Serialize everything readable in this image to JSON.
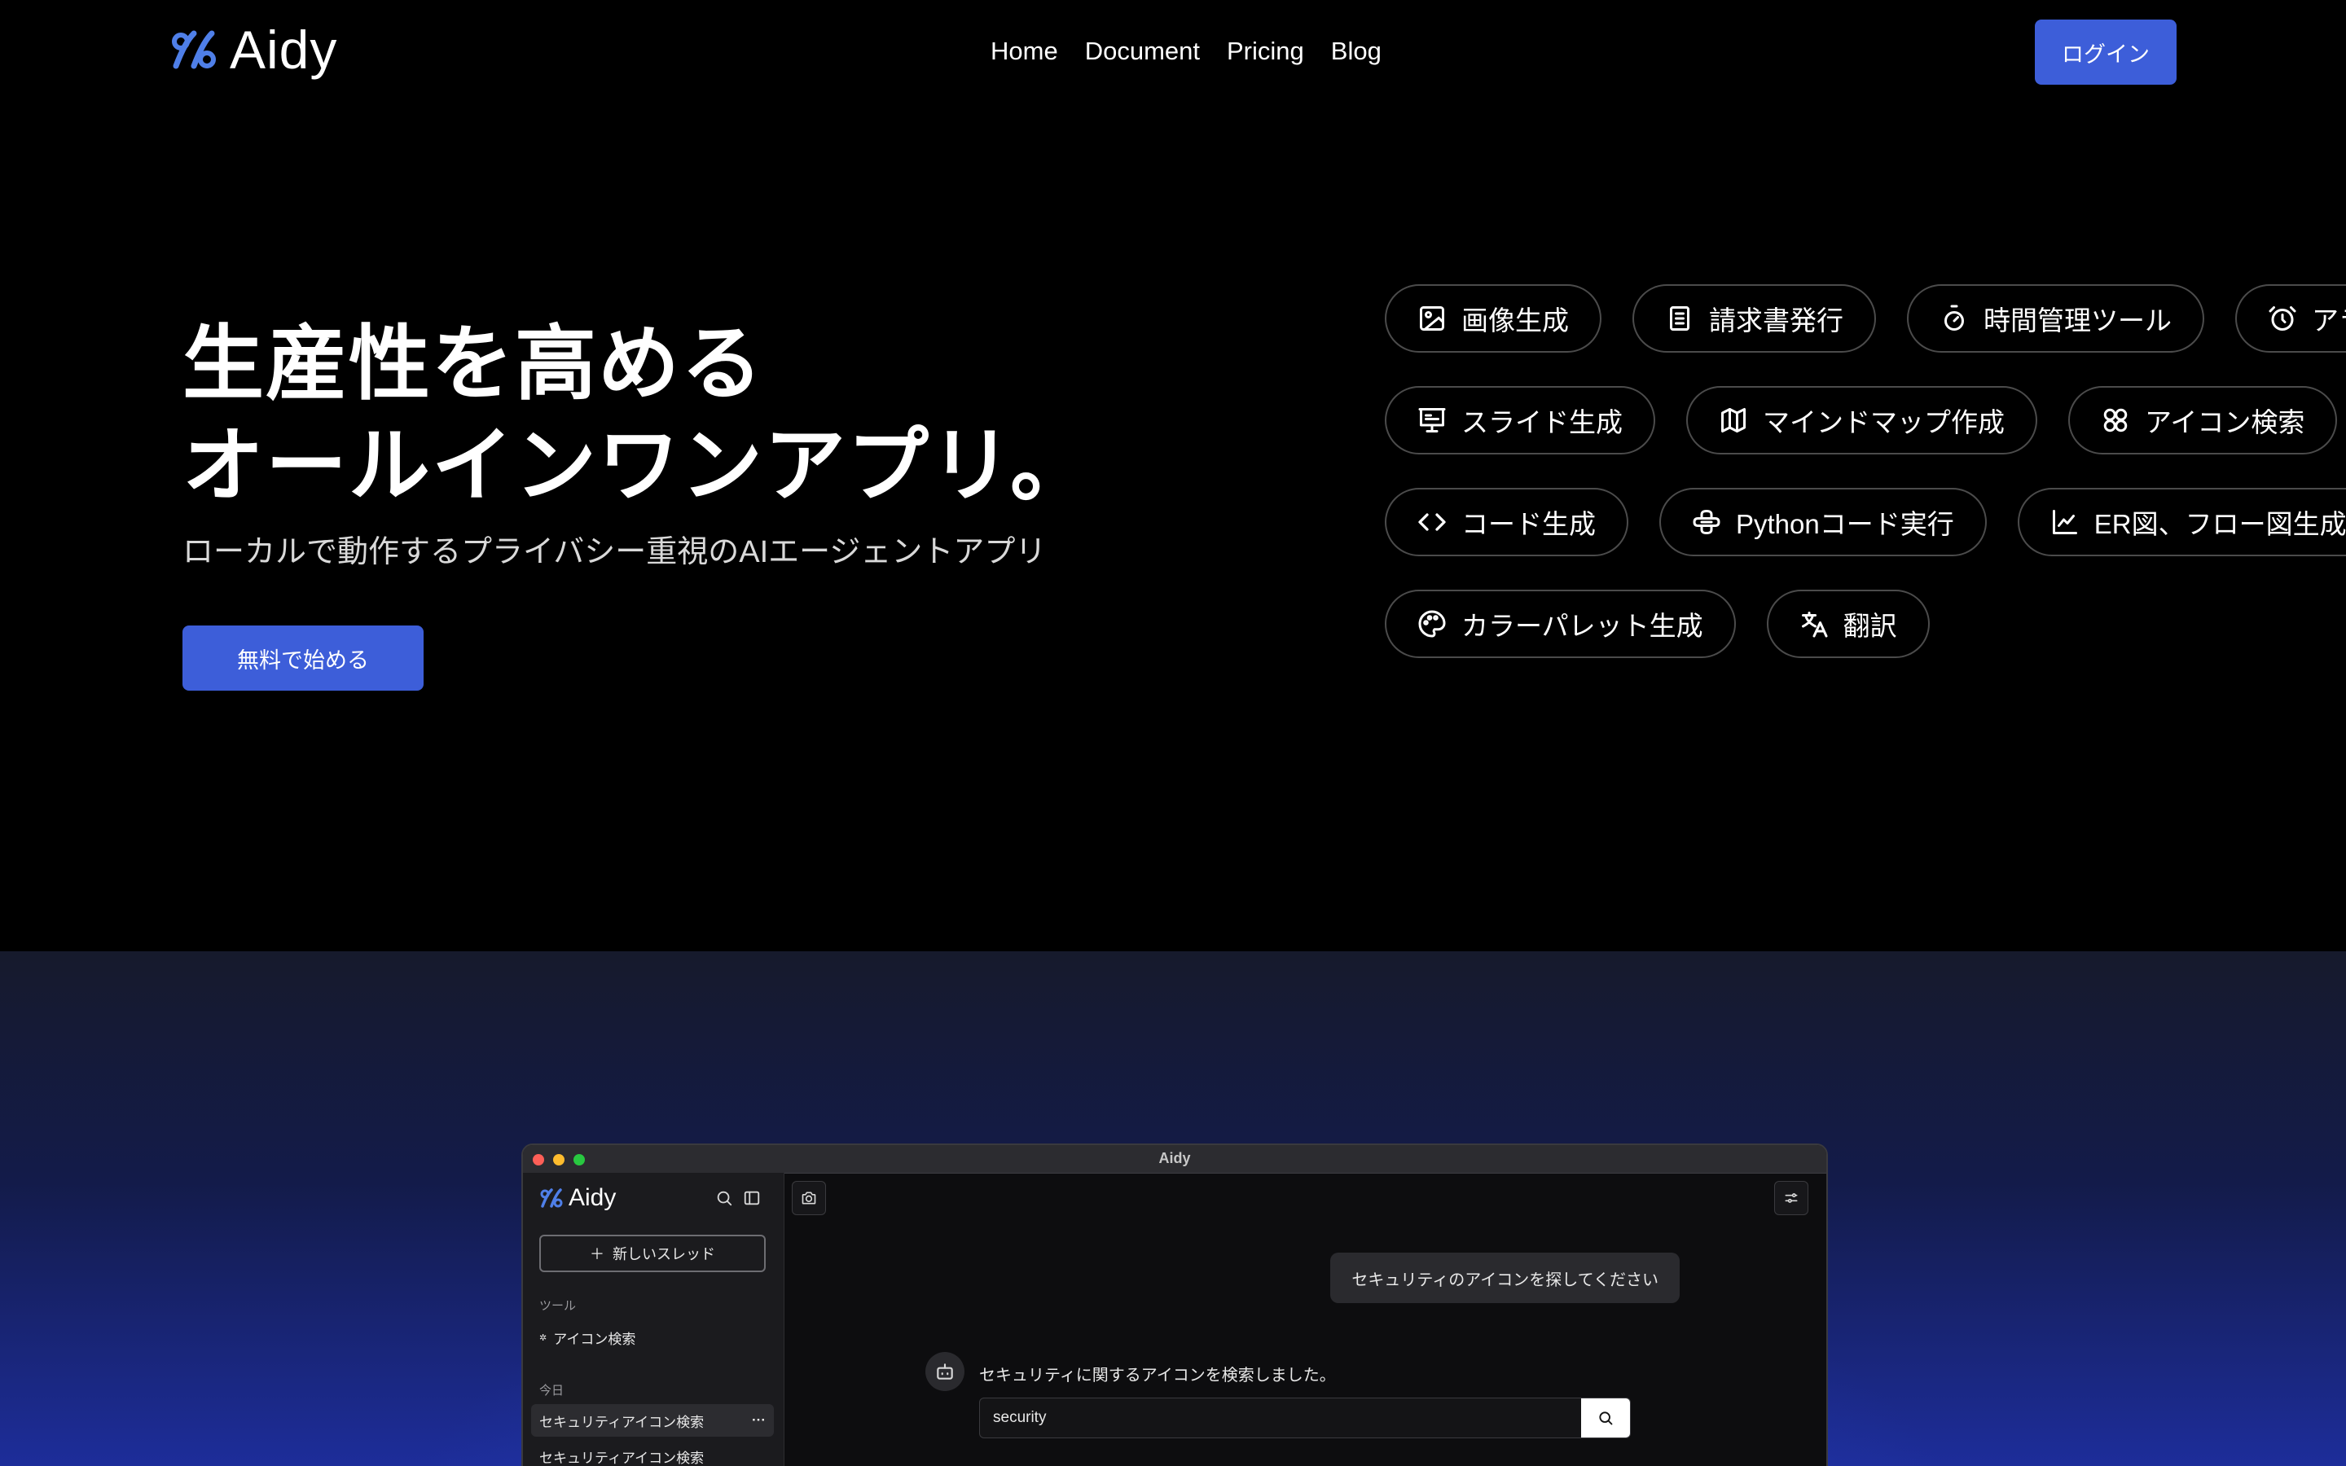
{
  "header": {
    "logo_text": "Aidy",
    "nav": [
      "Home",
      "Document",
      "Pricing",
      "Blog"
    ],
    "login_label": "ログイン"
  },
  "hero": {
    "title_line1": "生産性を高める",
    "title_line2": "オールインワンアプリ。",
    "subtitle": "ローカルで動作するプライバシー重視のAIエージェントアプリ",
    "cta_label": "無料で始める"
  },
  "features": {
    "rows": [
      [
        {
          "label": "画像生成",
          "icon": "image-icon"
        },
        {
          "label": "請求書発行",
          "icon": "document-icon"
        },
        {
          "label": "時間管理ツール",
          "icon": "timer-icon"
        },
        {
          "label": "アラ",
          "icon": "alarm-icon"
        }
      ],
      [
        {
          "label": "スライド生成",
          "icon": "slides-icon"
        },
        {
          "label": "マインドマップ作成",
          "icon": "map-icon"
        },
        {
          "label": "アイコン検索",
          "icon": "icons-icon"
        }
      ],
      [
        {
          "label": "コード生成",
          "icon": "code-icon"
        },
        {
          "label": "Pythonコード実行",
          "icon": "python-icon"
        },
        {
          "label": "ER図、フロー図生成",
          "icon": "chart-icon"
        }
      ],
      [
        {
          "label": "カラーパレット生成",
          "icon": "palette-icon"
        },
        {
          "label": "翻訳",
          "icon": "translate-icon"
        }
      ]
    ]
  },
  "app_window": {
    "title": "Aidy",
    "sidebar": {
      "logo_text": "Aidy",
      "new_thread_label": "新しいスレッド",
      "tools_heading": "ツール",
      "tool_item": "アイコン検索",
      "today_heading": "今日",
      "threads": [
        "セキュリティアイコン検索",
        "セキュリティアイコン検索"
      ],
      "more_label": "···"
    },
    "chat": {
      "user_message": "セキュリティのアイコンを探してください",
      "bot_message": "セキュリティに関するアイコンを検索しました。",
      "search_value": "security"
    }
  },
  "colors": {
    "accent": "#3d5ed9",
    "logo_blue": "#4f7fe8",
    "background": "#000000"
  }
}
